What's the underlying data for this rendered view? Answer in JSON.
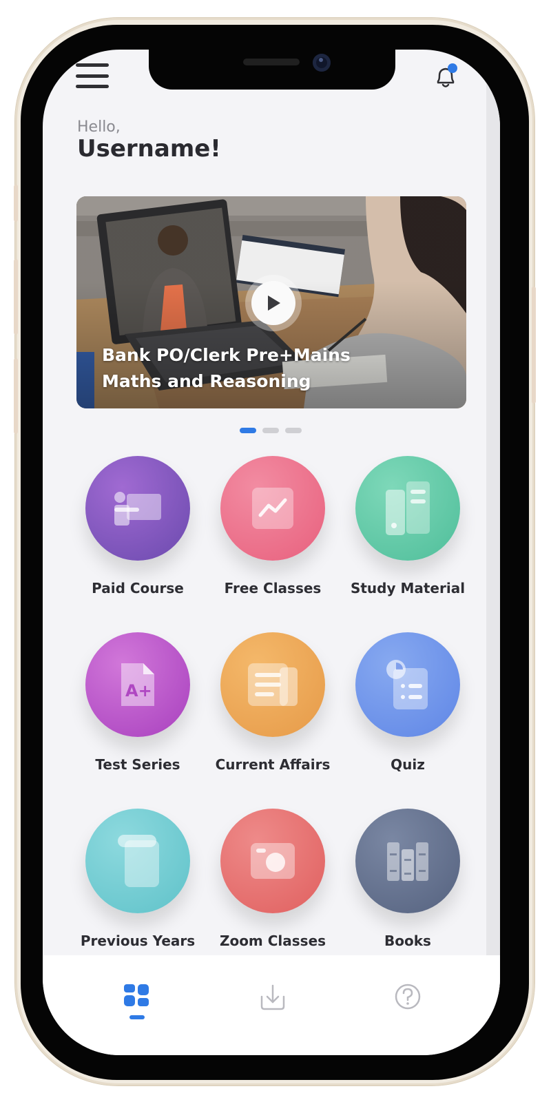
{
  "header": {
    "greeting": "Hello,",
    "username": "Username!"
  },
  "banner": {
    "title_line1": "Bank PO/Clerk Pre+Mains",
    "title_line2": "Maths and Reasoning",
    "active_slide": 1,
    "slide_count": 3
  },
  "categories": [
    {
      "label": "Paid Course",
      "icon": "classroom-icon",
      "color": "#7d55b8"
    },
    {
      "label": "Free Classes",
      "icon": "chart-icon",
      "color": "#ec6f8e"
    },
    {
      "label": "Study Material",
      "icon": "documents-icon",
      "color": "#5cc6a5"
    },
    {
      "label": "Test Series",
      "icon": "grade-icon",
      "color": "#b64ac6"
    },
    {
      "label": "Current Affairs",
      "icon": "newspaper-icon",
      "color": "#e9a452"
    },
    {
      "label": "Quiz",
      "icon": "quiz-icon",
      "color": "#6b8ee8"
    },
    {
      "label": "Previous Years",
      "icon": "paper-icon",
      "color": "#6fcbd1"
    },
    {
      "label": "Zoom Classes",
      "icon": "camera-icon",
      "color": "#e66f70"
    },
    {
      "label": "Books",
      "icon": "books-icon",
      "color": "#5d6c8c"
    }
  ],
  "nav": {
    "items": [
      {
        "icon": "dashboard-icon",
        "active": true
      },
      {
        "icon": "download-icon",
        "active": false
      },
      {
        "icon": "help-icon",
        "active": false
      }
    ]
  },
  "colors": {
    "accent": "#2f7ae5",
    "text_primary": "#2a2a30",
    "text_muted": "#8a8a90",
    "screen_bg": "#f4f4f7"
  }
}
